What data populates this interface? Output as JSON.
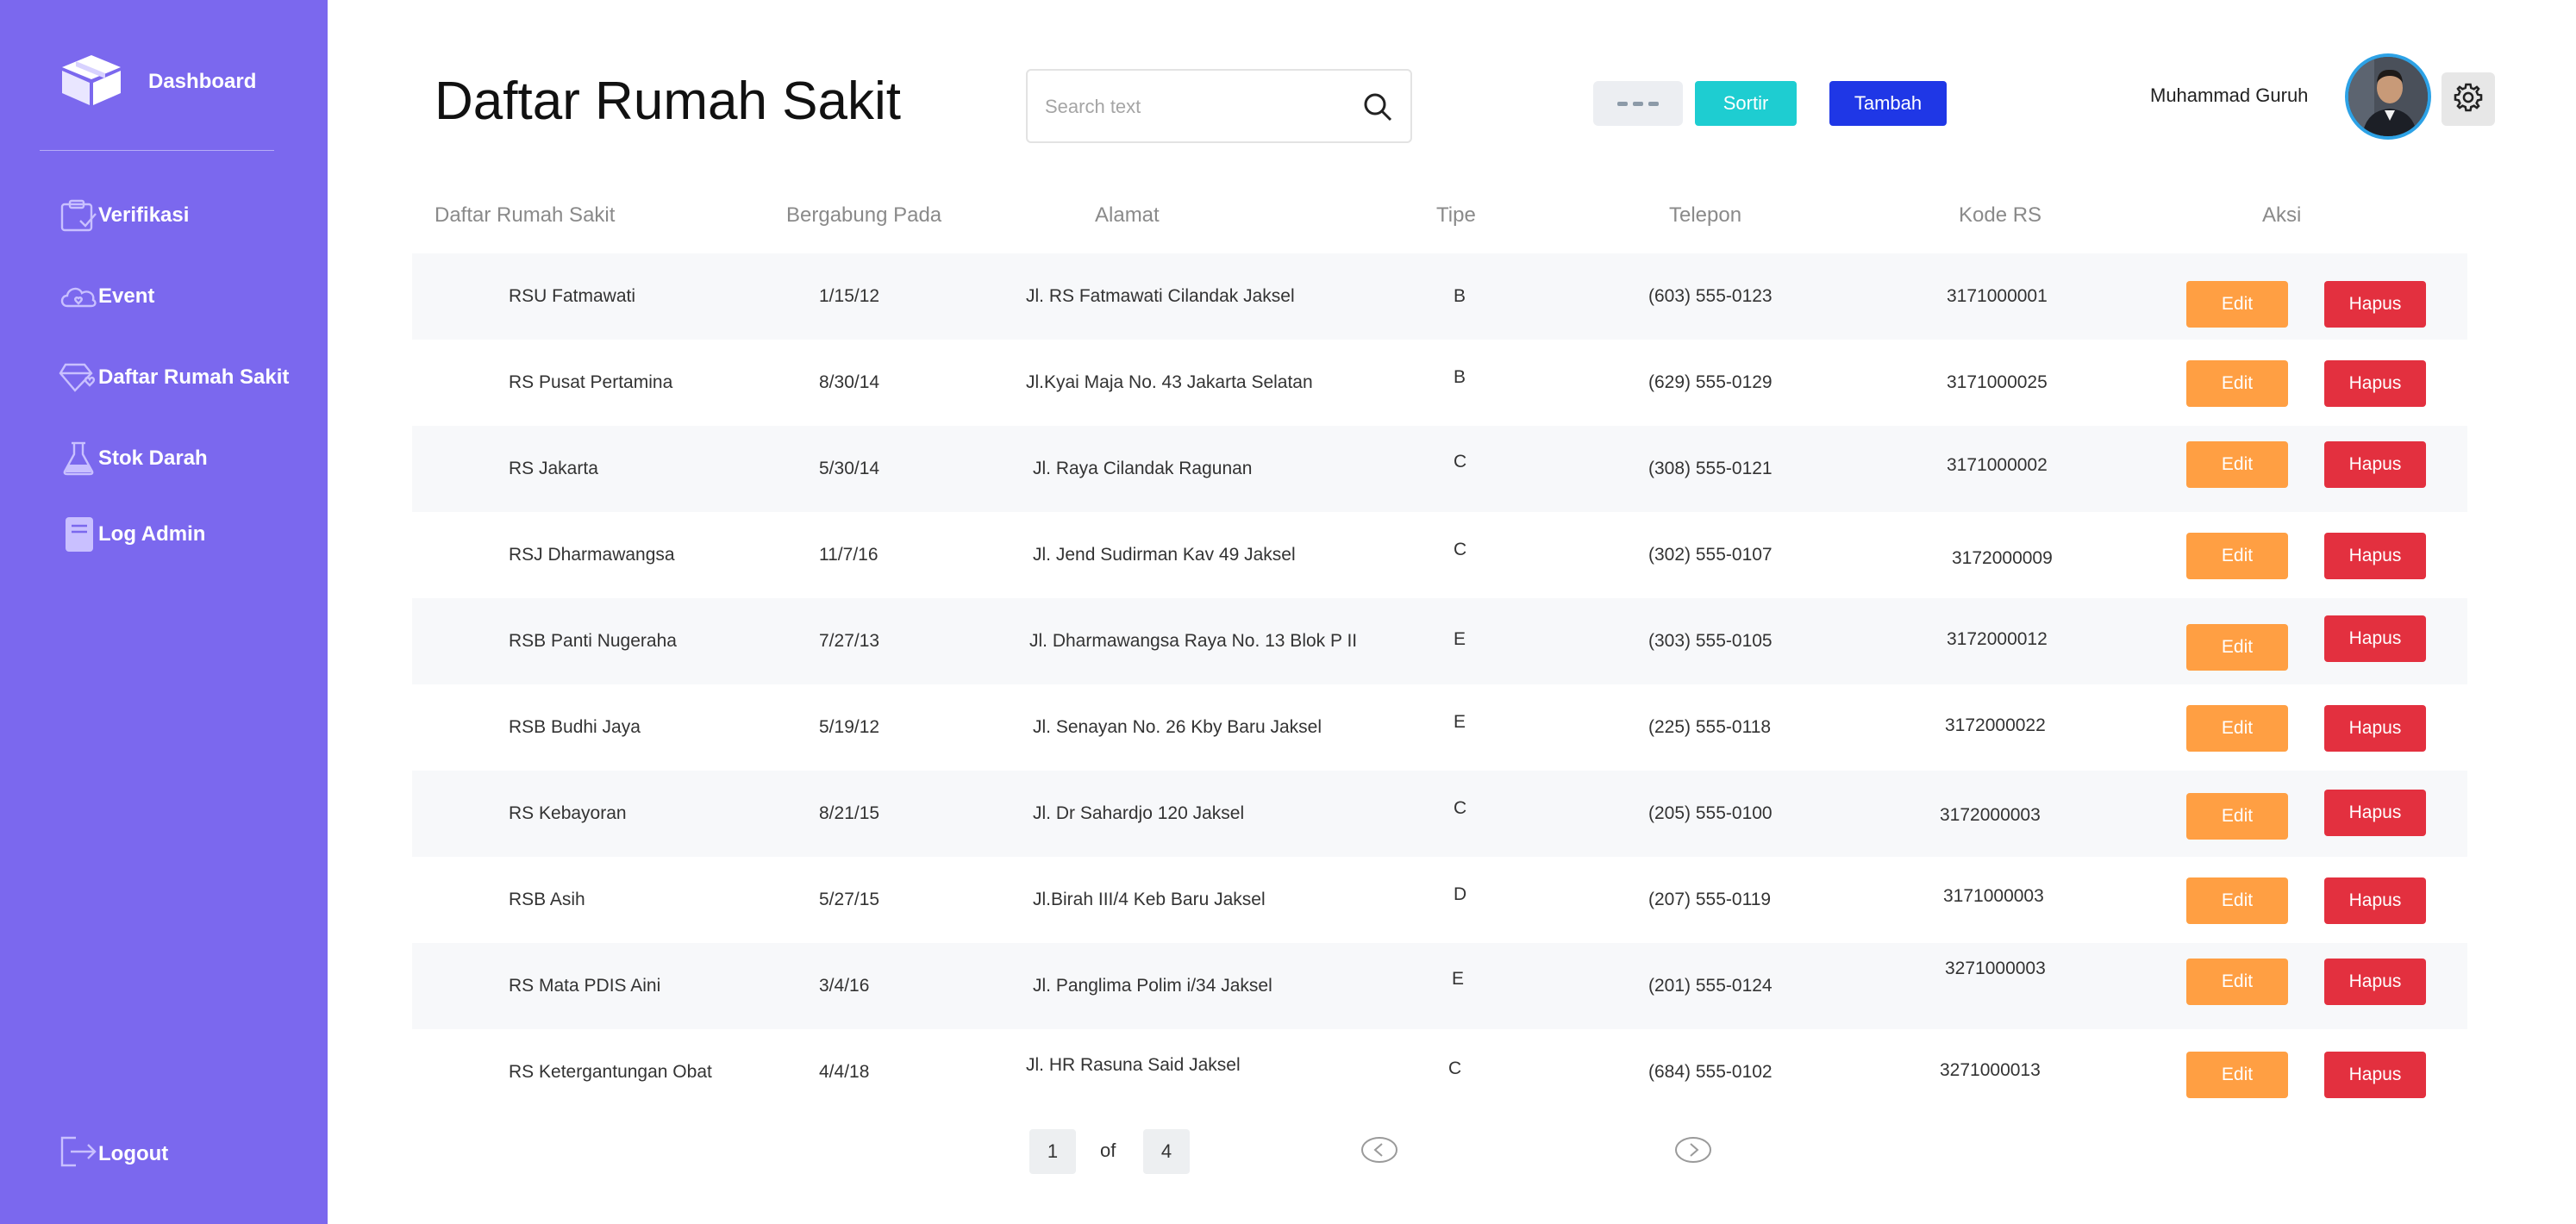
{
  "sidebar": {
    "brand_label": "Dashboard",
    "items": [
      {
        "label": "Verifikasi",
        "icon": "clipboard-check-icon"
      },
      {
        "label": "Event",
        "icon": "cloud-heart-icon"
      },
      {
        "label": "Daftar Rumah Sakit",
        "icon": "diamond-heart-icon"
      },
      {
        "label": "Stok Darah",
        "icon": "flask-icon"
      },
      {
        "label": "Log Admin",
        "icon": "book-icon"
      }
    ],
    "logout_label": "Logout"
  },
  "header": {
    "title": "Daftar Rumah Sakit",
    "search_placeholder": "Search text",
    "sortir_label": "Sortir",
    "tambah_label": "Tambah",
    "user_name": "Muhammad Guruh"
  },
  "table": {
    "columns": [
      "Daftar Rumah Sakit",
      "Bergabung Pada",
      "Alamat",
      "Tipe",
      "Telepon",
      "Kode RS",
      "Aksi"
    ],
    "rows": [
      {
        "name": "RSU Fatmawati",
        "joined": "1/15/12",
        "address": "Jl. RS Fatmawati Cilandak Jaksel",
        "type": "B",
        "phone": "(603) 555-0123",
        "code": "3171000001"
      },
      {
        "name": "RS Pusat Pertamina",
        "joined": "8/30/14",
        "address": "Jl.Kyai Maja No. 43 Jakarta Selatan",
        "type": "B",
        "phone": "(629) 555-0129",
        "code": "3171000025"
      },
      {
        "name": "RS Jakarta",
        "joined": "5/30/14",
        "address": "Jl. Raya Cilandak Ragunan",
        "type": "C",
        "phone": "(308) 555-0121",
        "code": "3171000002"
      },
      {
        "name": "RSJ Dharmawangsa",
        "joined": "11/7/16",
        "address": "Jl. Jend Sudirman Kav 49 Jaksel",
        "type": "C",
        "phone": "(302) 555-0107",
        "code": "3172000009"
      },
      {
        "name": "RSB Panti Nugeraha",
        "joined": "7/27/13",
        "address": "Jl. Dharmawangsa Raya No. 13 Blok P II",
        "type": "E",
        "phone": "(303) 555-0105",
        "code": "3172000012"
      },
      {
        "name": "RSB Budhi Jaya",
        "joined": "5/19/12",
        "address": "Jl. Senayan No. 26 Kby Baru Jaksel",
        "type": "E",
        "phone": "(225) 555-0118",
        "code": "3172000022"
      },
      {
        "name": "RS Kebayoran",
        "joined": "8/21/15",
        "address": "Jl. Dr Sahardjo 120 Jaksel",
        "type": "C",
        "phone": "(205) 555-0100",
        "code": "3172000003"
      },
      {
        "name": "RSB Asih",
        "joined": "5/27/15",
        "address": "Jl.Birah III/4 Keb Baru Jaksel",
        "type": "D",
        "phone": "(207) 555-0119",
        "code": "3171000003"
      },
      {
        "name": "RS Mata PDIS Aini",
        "joined": "3/4/16",
        "address": "Jl. Panglima Polim i/34 Jaksel",
        "type": "E",
        "phone": "(201) 555-0124",
        "code": "3271000003"
      },
      {
        "name": "RS Ketergantungan Obat",
        "joined": "4/4/18",
        "address": "Jl. HR Rasuna Said Jaksel",
        "type": "C",
        "phone": "(684) 555-0102",
        "code": "3271000013"
      }
    ],
    "edit_label": "Edit",
    "delete_label": "Hapus"
  },
  "pagination": {
    "current_page": "1",
    "of_label": "of",
    "total_pages": "4"
  },
  "colors": {
    "sidebar_bg": "#7b68ee",
    "sortir": "#1ecdd1",
    "tambah": "#1f37e6",
    "edit": "#ff9f43",
    "hapus": "#e3303f"
  }
}
